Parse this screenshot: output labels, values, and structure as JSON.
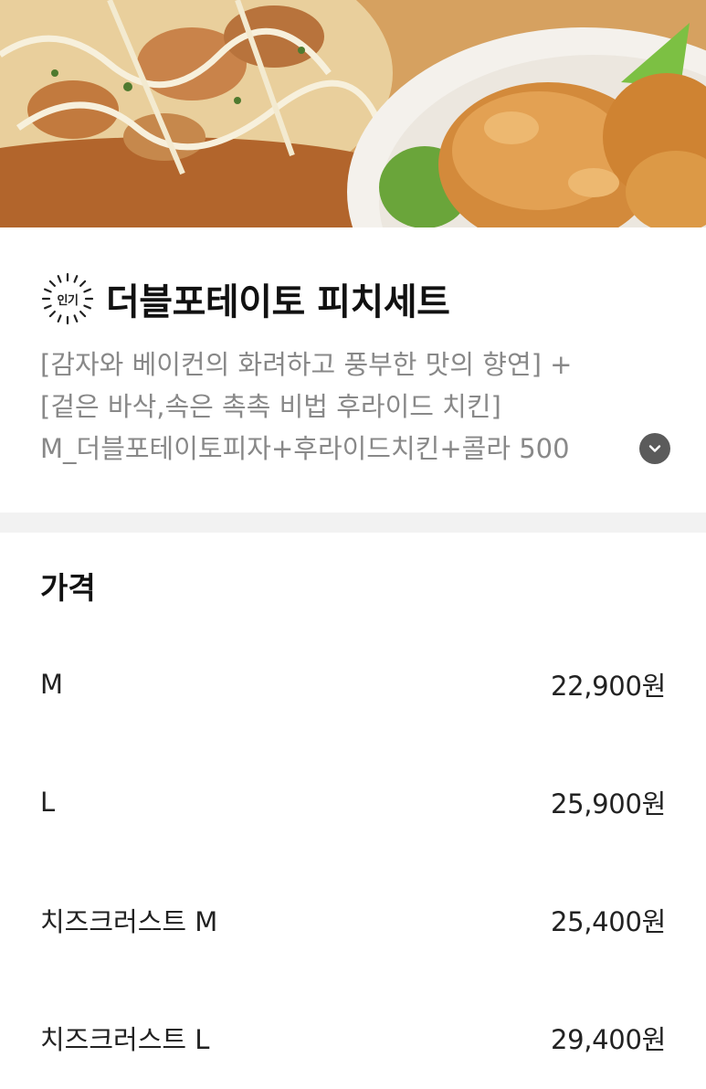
{
  "hero": {
    "image": "pizza-and-fried-chicken-photo"
  },
  "menu": {
    "badge_label": "인기",
    "title": "더블포테이토 피치세트",
    "description_lines": [
      "[감자와 베이컨의 화려하고 풍부한 맛의 향연] +",
      "[겉은 바삭,속은 촉촉 비법 후라이드 치킨]",
      "M_더블포테이토피자+후라이드치킨+콜라 500"
    ],
    "expand_icon": "chevron-down-icon"
  },
  "price": {
    "header": "가격",
    "options": [
      {
        "label": "M",
        "price": "22,900원"
      },
      {
        "label": "L",
        "price": "25,900원"
      },
      {
        "label": "치즈크러스트 M",
        "price": "25,400원"
      },
      {
        "label": "치즈크러스트 L",
        "price": "29,400원"
      }
    ]
  },
  "colors": {
    "divider": "#f2f2f2",
    "description": "#888888",
    "expand_button": "#5b5b5b"
  }
}
